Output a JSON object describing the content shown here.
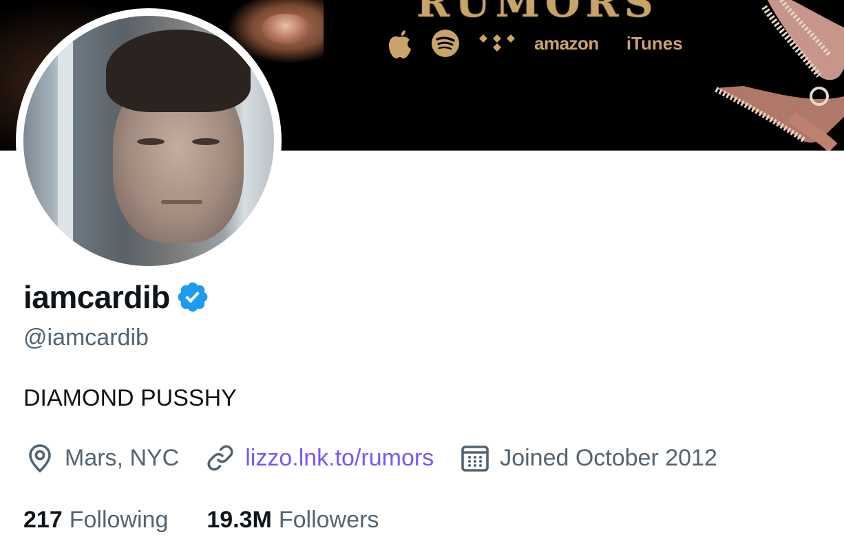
{
  "banner": {
    "title": "RUMORS",
    "stores": [
      {
        "icon": "apple-icon"
      },
      {
        "icon": "spotify-icon"
      },
      {
        "icon": "tidal-icon"
      },
      {
        "icon": "amazon-logo",
        "label": "amazon"
      },
      {
        "icon": "itunes-logo",
        "label": "iTunes"
      }
    ],
    "colors": {
      "gold": "#c9a46a",
      "background": "#000000"
    }
  },
  "profile": {
    "display_name": "iamcardib",
    "verified": true,
    "handle": "@iamcardib",
    "bio": "DIAMOND PUSSHY",
    "location": "Mars, NYC",
    "website": "lizzo.lnk.to/rumors",
    "joined": "Joined October 2012",
    "following_count": "217",
    "following_label": "Following",
    "followers_count": "19.3M",
    "followers_label": "Followers"
  },
  "icons": {
    "location": "map-pin-icon",
    "link": "link-icon",
    "calendar": "calendar-icon",
    "verified": "verified-badge-icon"
  },
  "colors": {
    "text_primary": "#0f1419",
    "text_secondary": "#536471",
    "link": "#7856ff",
    "verified": "#1d9bf0"
  }
}
